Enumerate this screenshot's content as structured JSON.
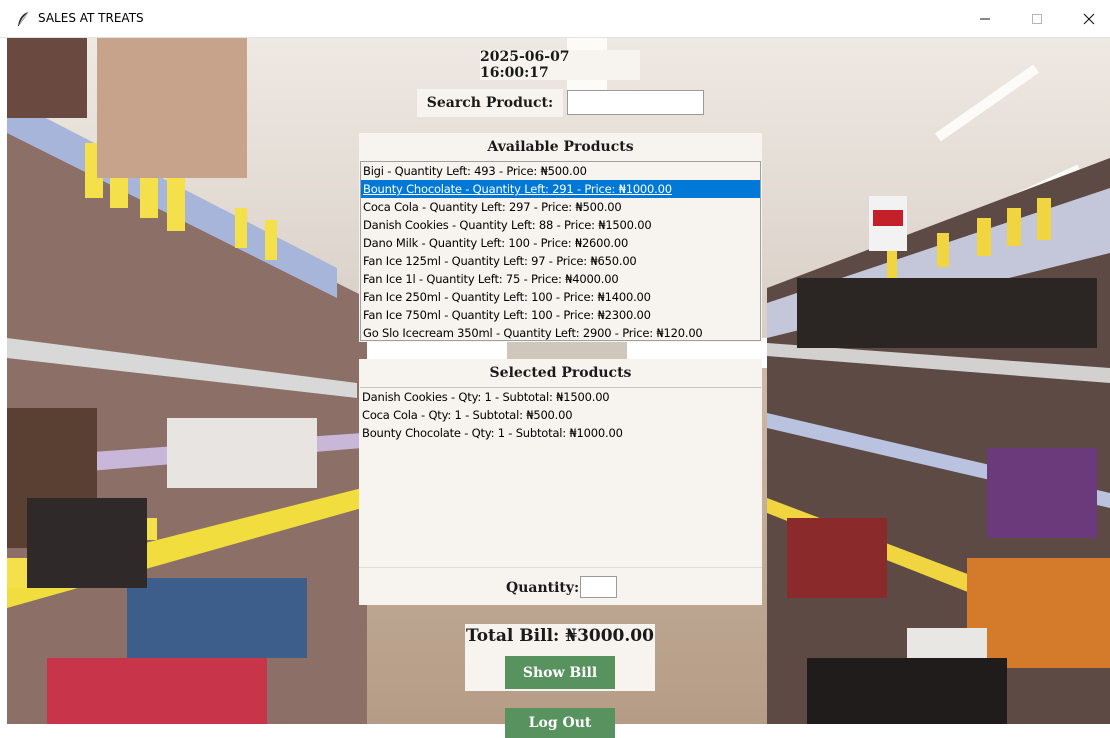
{
  "window": {
    "title": "SALES AT TREATS",
    "icon": "feather-icon"
  },
  "datetime": "2025-06-07 16:00:17",
  "search": {
    "label": "Search Product:",
    "value": "",
    "placeholder": ""
  },
  "available": {
    "heading": "Available Products",
    "items": [
      "Bigi - Quantity Left: 493 - Price: ₦500.00",
      "Bounty Chocolate - Quantity Left: 291 - Price: ₦1000.00",
      "Coca Cola - Quantity Left: 297 - Price: ₦500.00",
      "Danish Cookies - Quantity Left: 88 - Price: ₦1500.00",
      "Dano Milk - Quantity Left: 100 - Price: ₦2600.00",
      "Fan Ice 125ml - Quantity Left: 97 - Price: ₦650.00",
      "Fan Ice 1l - Quantity Left: 75 - Price: ₦4000.00",
      "Fan Ice 250ml - Quantity Left: 100 - Price: ₦1400.00",
      "Fan Ice 750ml - Quantity Left: 100 - Price: ₦2300.00",
      "Go Slo Icecream 350ml - Quantity Left: 2900 - Price: ₦120.00"
    ],
    "selected_index": 1
  },
  "selected": {
    "heading": "Selected Products",
    "items": [
      "Danish Cookies - Qty: 1 - Subtotal: ₦1500.00",
      "Coca Cola - Qty: 1 - Subtotal: ₦500.00",
      "Bounty Chocolate - Qty: 1 - Subtotal: ₦1000.00"
    ]
  },
  "quantity": {
    "label": "Quantity:",
    "value": ""
  },
  "bill": {
    "total_label": "Total Bill: ₦3000.00"
  },
  "buttons": {
    "show_bill": "Show Bill",
    "logout": "Log Out"
  },
  "colors": {
    "panel": "#f7f3ee",
    "selection": "#0078d7",
    "button": "#58935f"
  }
}
